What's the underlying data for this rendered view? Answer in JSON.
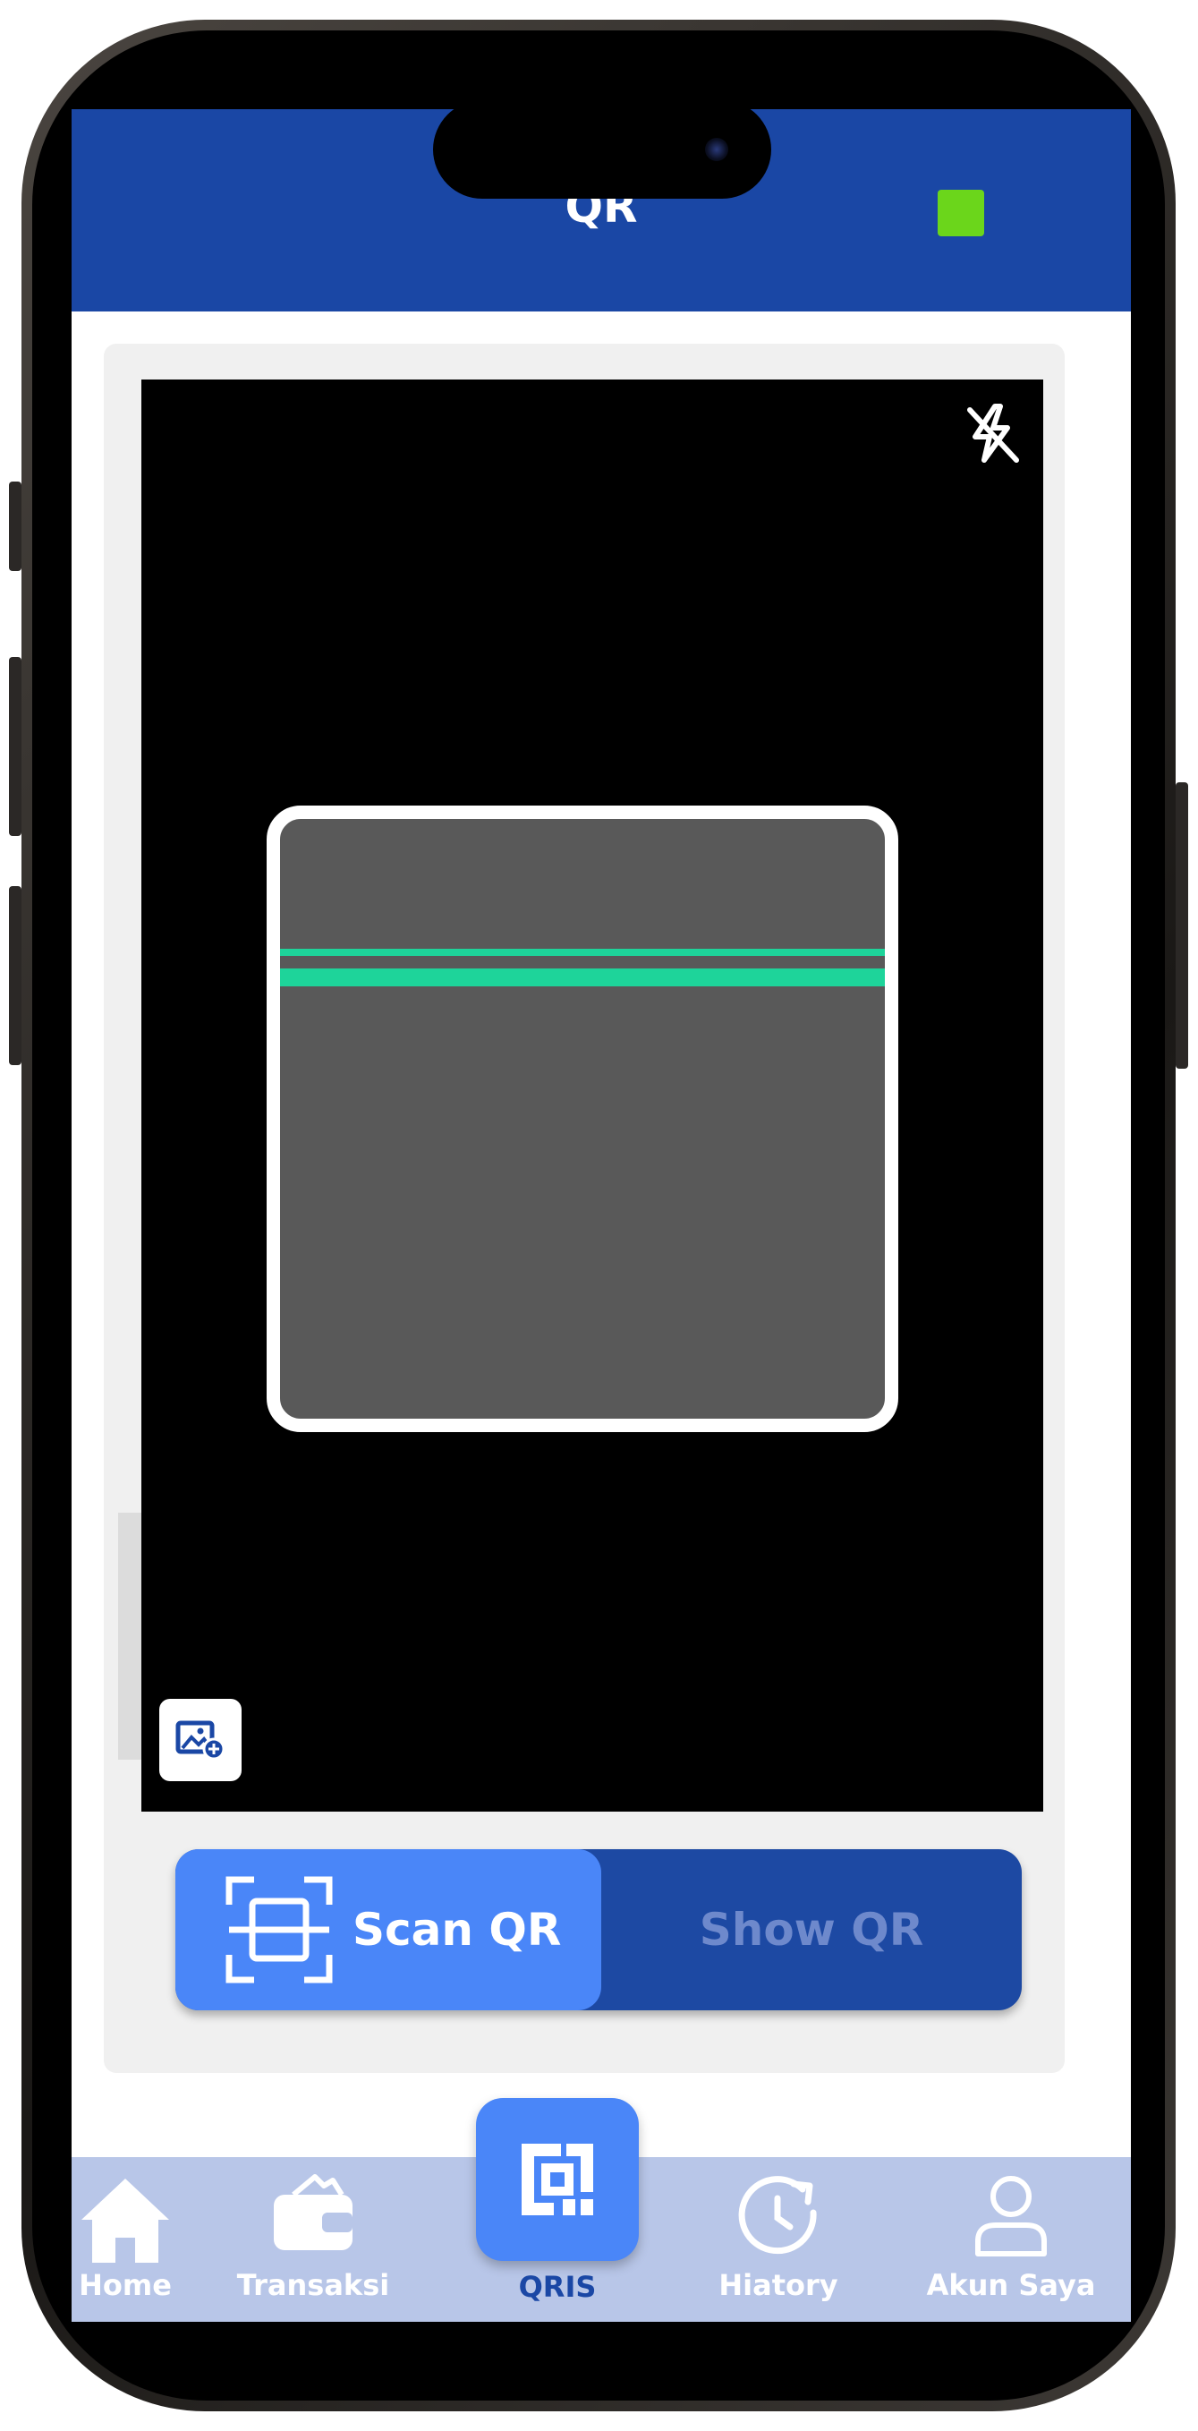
{
  "header": {
    "title": "QR"
  },
  "scanner": {
    "flash_icon": "flash-off-icon",
    "gallery_icon": "image-add-icon",
    "scan_line_color": "#1ed49a"
  },
  "toggle": {
    "scan_label": "Scan QR",
    "scan_icon": "scan-frame-icon",
    "show_label": "Show QR",
    "active": "Scan QR"
  },
  "nav": {
    "items": [
      {
        "label": "Home",
        "icon": "home-icon"
      },
      {
        "label": "Transaksi",
        "icon": "wallet-icon"
      },
      {
        "label": "QRIS",
        "icon": "qris-icon",
        "active": true
      },
      {
        "label": "Hiatory",
        "icon": "history-icon"
      },
      {
        "label": "Akun Saya",
        "icon": "user-icon"
      }
    ]
  },
  "colors": {
    "header": "#1a47a5",
    "accent": "#4a86f8",
    "toggle_bg": "#1d49a3",
    "nav_bg": "#b8c6e8",
    "status": "#6bd61b"
  }
}
